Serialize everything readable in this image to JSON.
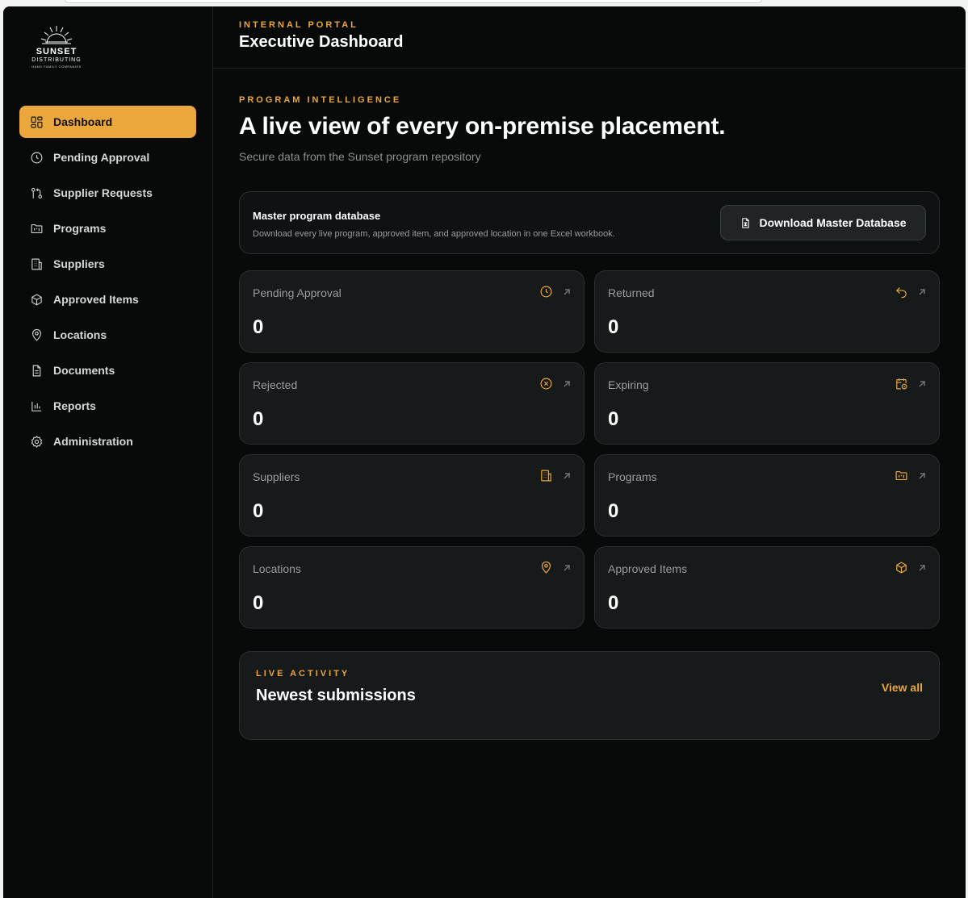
{
  "brand": {
    "name": "SUNSET",
    "line2": "DISTRIBUTING",
    "line3": "HAND FAMILY COMPANIES",
    "accent": "#e9a73c"
  },
  "sidebar": {
    "items": [
      {
        "label": "Dashboard",
        "icon": "dashboard-icon",
        "active": true
      },
      {
        "label": "Pending Approval",
        "icon": "clock-icon"
      },
      {
        "label": "Supplier Requests",
        "icon": "git-pull-request-icon"
      },
      {
        "label": "Programs",
        "icon": "folder-kanban-icon"
      },
      {
        "label": "Suppliers",
        "icon": "building-icon"
      },
      {
        "label": "Approved Items",
        "icon": "package-icon"
      },
      {
        "label": "Locations",
        "icon": "map-pin-icon"
      },
      {
        "label": "Documents",
        "icon": "document-icon"
      },
      {
        "label": "Reports",
        "icon": "bar-chart-icon"
      },
      {
        "label": "Administration",
        "icon": "gear-icon"
      }
    ]
  },
  "header": {
    "eyebrow": "INTERNAL PORTAL",
    "title": "Executive Dashboard"
  },
  "hero": {
    "eyebrow": "PROGRAM INTELLIGENCE",
    "title": "A live view of every on-premise placement.",
    "subtitle": "Secure data from the Sunset program repository"
  },
  "database": {
    "title": "Master program database",
    "description": "Download every live program, approved item, and approved location in one Excel workbook.",
    "button": "Download Master Database"
  },
  "stats": [
    {
      "label": "Pending Approval",
      "value": "0",
      "icon": "clock-icon"
    },
    {
      "label": "Returned",
      "value": "0",
      "icon": "undo-icon"
    },
    {
      "label": "Rejected",
      "value": "0",
      "icon": "x-circle-icon"
    },
    {
      "label": "Expiring",
      "value": "0",
      "icon": "calendar-clock-icon"
    },
    {
      "label": "Suppliers",
      "value": "0",
      "icon": "building-icon"
    },
    {
      "label": "Programs",
      "value": "0",
      "icon": "folder-kanban-icon"
    },
    {
      "label": "Locations",
      "value": "0",
      "icon": "map-pin-icon"
    },
    {
      "label": "Approved Items",
      "value": "0",
      "icon": "package-icon"
    }
  ],
  "activity": {
    "eyebrow": "LIVE ACTIVITY",
    "title": "Newest submissions",
    "link": "View all"
  }
}
